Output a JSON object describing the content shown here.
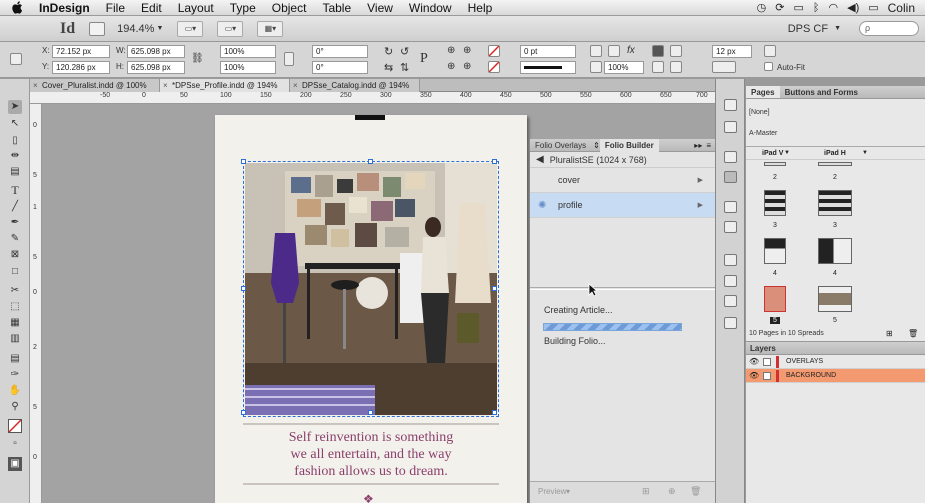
{
  "menubar": {
    "apple": "",
    "app_name": "InDesign",
    "items": [
      "File",
      "Edit",
      "Layout",
      "Type",
      "Object",
      "Table",
      "View",
      "Window",
      "Help"
    ],
    "user": "Colin"
  },
  "appbar": {
    "logo": "Id",
    "zoom": "194.4%",
    "workspace": "DPS CF",
    "search_placeholder": "ρ"
  },
  "control": {
    "x_label": "X:",
    "x_value": "72.152 px",
    "y_label": "Y:",
    "y_value": "120.286 px",
    "w_label": "W:",
    "w_value": "625.098 px",
    "h_label": "H:",
    "h_value": "625.098 px",
    "scale_x": "100%",
    "scale_y": "100%",
    "rotate": "0°",
    "shear": "0°",
    "stroke_weight": "0 pt",
    "opacity": "100%",
    "fit_value": "12 px",
    "autofit_label": "Auto-Fit"
  },
  "tabs": [
    {
      "label": "Cover_Pluralist.indd @ 100%",
      "active": false
    },
    {
      "label": "*DPSse_Profile.indd @ 194%",
      "active": true
    },
    {
      "label": "DPSse_Catalog.indd @ 194%",
      "active": false
    }
  ],
  "ruler": {
    "h_ticks": [
      "-50",
      "0",
      "50",
      "100",
      "150",
      "200",
      "250",
      "300",
      "350",
      "400",
      "450",
      "500",
      "550",
      "600",
      "650",
      "700"
    ],
    "v_ticks": [
      "0",
      "5",
      "1",
      "5",
      "0",
      "2",
      "5",
      "0"
    ]
  },
  "document": {
    "caption": [
      "Self reinvention is something",
      "we all entertain, and the way",
      "fashion allows us to dream."
    ],
    "ornament": "❖"
  },
  "folio": {
    "tabs": [
      "Folio Overlays",
      "Folio Builder"
    ],
    "menu_icon": "≡",
    "folio_name": "PluralistSE  (1024 x 768)",
    "articles": [
      {
        "name": "cover",
        "selected": false
      },
      {
        "name": "profile",
        "selected": true
      }
    ],
    "status1": "Creating Article...",
    "progress": 1.0,
    "status2": "Building Folio...",
    "preview_label": "Preview"
  },
  "pages": {
    "tabs": [
      "Pages",
      "Buttons and Forms"
    ],
    "none_label": "[None]",
    "master_label": "A-Master",
    "col1": "iPad V",
    "col2": "iPad H",
    "page_numbers": [
      "2",
      "2",
      "3",
      "3",
      "4",
      "4",
      "5",
      "5"
    ],
    "summary": "10 Pages in 10 Spreads"
  },
  "layers": {
    "title": "Layers",
    "items": [
      {
        "name": "OVERLAYS",
        "selected": false
      },
      {
        "name": "BACKGROUND",
        "selected": true
      }
    ]
  },
  "colors": {
    "caption": "#8b3f6b",
    "selection": "#2d6fd6",
    "layer_selected": "#f49a70",
    "article_selected": "#c7dbf3"
  }
}
